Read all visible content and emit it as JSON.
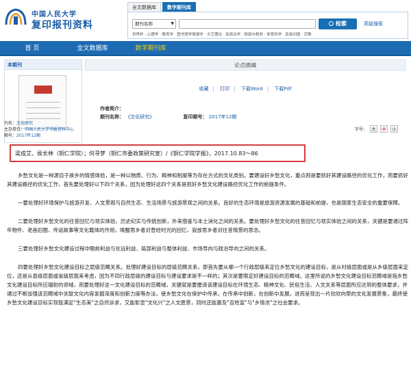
{
  "header": {
    "logo_line1": "中国人民大学",
    "logo_line2": "复印报刊资料",
    "search_tabs": [
      "全文数据库",
      "数字期刊库"
    ],
    "search_select": "期刊名称",
    "search_input_value": "",
    "search_button": "检索",
    "advanced_search": "高级搜索",
    "categories": "世界杯 · 心理学 · 教育学 · 图书馆学情报学 · 文艺理论 · 民商法学 · 财政与税务 · 体育科学 · 民族问题 · 宗教"
  },
  "nav": {
    "home": "首 页",
    "full_text": "全文数据库",
    "digital": "数字期刊库"
  },
  "sidebar": {
    "title": "本期刊",
    "meta_lines": [
      {
        "label": "刊名：",
        "value": "文化研究"
      },
      {
        "label": "主办单位：",
        "value": "中国人民大学书报资料中心"
      },
      {
        "label": "期号：",
        "value": "2017年12期"
      }
    ]
  },
  "article": {
    "section_title": "论点摘编",
    "tools": [
      "收藏",
      "打印",
      "下载Word",
      "下载Pdf"
    ],
    "author_label": "作者简介：",
    "issue_label": "期刊名称：",
    "issue_value": "《文化研究》",
    "pub_label": "复印期号：",
    "pub_value": "2017年12期",
    "font_size_label": "字号：",
    "font_buttons": [
      "大",
      "中",
      "小"
    ],
    "citation": "梁成艾、侯长林（铜仁学院）；何寻梦（铜仁市委政策研究室）/《铜仁学院学报》，2017.10.83～86",
    "paragraphs": [
      "乡愁文化是一种源自于故乡的情感体验，是一种以物质、行为、精神和制度等为存在方式的文化类别。要建设好乡愁文化，重点则是要抓好其建设路径的优化工作，而要抓好其建设路径的优化工作，首先要处理好以下四个关系，因为处理好这四个关系是抓好乡愁文化建设路径优化工作的前提条件。",
      "一要处理好环境保护与旅游开发、人文景观与自然生态、生活场景与旅游景观之间的关系。良好的生态环境是旅游资源发展的基础和前提，也是国家生态安全的重要保障。",
      "二要处理好乡愁文化的往昔回忆与现实体验，历史纪实与传统创新，外来借鉴与本土消化之间的关系。要处理好乡愁文化的往昔回忆与现实体验之间的关系，关键是要通过阵年物件、老画旧图、传说故事等文化载体的作用，唤醒思乡者对曾经时光的回忆，寂放思乡者对往昔情景的思念。",
      "三要处理好乡愁文化建设过程中眼前利益与长远利益、局部利益与整体利益、市场导向与政治导向之间的关系。",
      "四要处理好乡愁文化建设目标之层级范畴关系。处理好建设目标的层级范畴关系，即首先要从哪一个行政层级来定位乡愁文化的建设目标，是从村级层面或是从乡级层面来定位，还是从县级层面或省级层面来考虑，因为不同行政层级的建设目标与建设要求是不一样的；其次是要限定好建设目标的范畴域。这里所说的乡愁文化建设目标范畴域是指乡愁文化建设目标所应辐射的领域，而要处理好这一文化建设目标的范畴域，关键就是要厘清该建设目标在环境生态、精神文化、民俗生活、人文关系等层面所应达到的整体要求，并通过不断加强该范畴域中关联文化内容发掘深度和创新力度等办法，使乡愁文化在保护中传承，在传承中创新，在创新中发展，进而呈现出一片欣欣向荣的文化发展景象，最终使乡愁文化建设目标实现既满足\"生态美\"之自然诉求，又能彰显\"文化兴\"之人文愿景，同时还能惠及\"百姓富\"与\"乡情浓\"之社会要求。"
    ]
  }
}
